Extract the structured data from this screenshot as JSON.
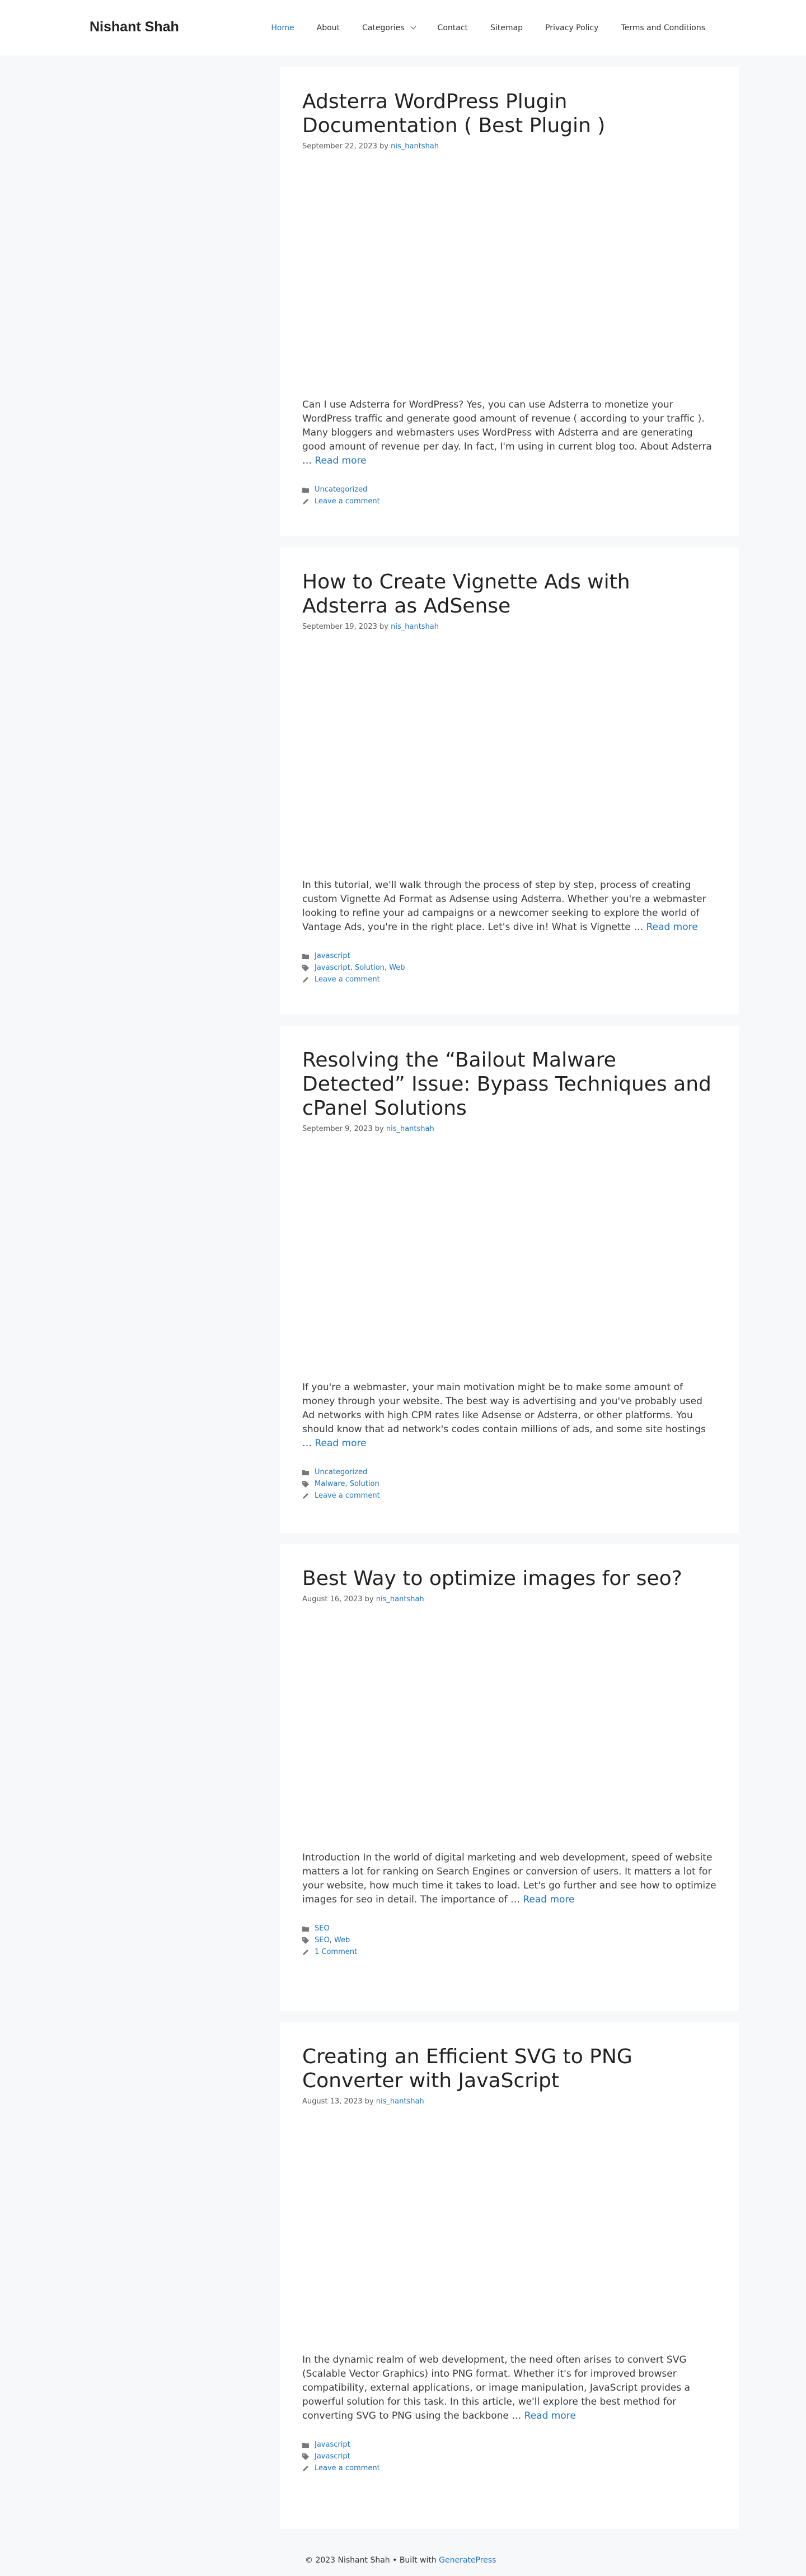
{
  "site": {
    "title": "Nishant Shah"
  },
  "nav": [
    {
      "label": "Home",
      "active": true
    },
    {
      "label": "About"
    },
    {
      "label": "Categories",
      "dropdown": true
    },
    {
      "label": "Contact"
    },
    {
      "label": "Sitemap"
    },
    {
      "label": "Privacy Policy"
    },
    {
      "label": "Terms and Conditions"
    }
  ],
  "read_more": "Read more",
  "posts": [
    {
      "title": "Adsterra WordPress Plugin Documentation ( Best Plugin )",
      "date": "September 22, 2023",
      "by": "by",
      "author": "nis_hantshah",
      "excerpt": "Can I use Adsterra for WordPress? Yes, you can use Adsterra to monetize your WordPress traffic and generate good amount of revenue ( according to your traffic ). Many bloggers and webmasters uses WordPress with Adsterra and are generating good amount of revenue per day. In fact, I'm using in current blog too. About Adsterra …",
      "categories": [
        "Uncategorized"
      ],
      "tags": [],
      "comments": "Leave a comment"
    },
    {
      "title": "How to Create Vignette Ads with Adsterra as AdSense",
      "date": "September 19, 2023",
      "by": "by",
      "author": "nis_hantshah",
      "excerpt": "In this tutorial, we'll walk through the process of step by step, process of creating custom Vignette Ad Format as Adsense using Adsterra. Whether you're a webmaster looking to refine your ad campaigns or a newcomer seeking to explore the world of Vantage Ads, you're in the right place. Let's dive in! What is Vignette …",
      "categories": [
        "Javascript"
      ],
      "tags": [
        "Javascript",
        "Solution",
        "Web"
      ],
      "comments": "Leave a comment"
    },
    {
      "title": "Resolving the “Bailout Malware Detected” Issue: Bypass Techniques and cPanel Solutions",
      "date": "September 9, 2023",
      "by": "by",
      "author": "nis_hantshah",
      "excerpt": "If you're a webmaster, your main motivation might be to make some amount of money through your website. The best way is advertising and you've probably used Ad networks with high CPM rates like Adsense or Adsterra, or other platforms. You should know that ad network's codes contain millions of ads, and some site hostings …",
      "categories": [
        "Uncategorized"
      ],
      "tags": [
        "Malware",
        "Solution"
      ],
      "comments": "Leave a comment"
    },
    {
      "title": "Best Way to optimize images for seo?",
      "date": "August 16, 2023",
      "by": "by",
      "author": "nis_hantshah",
      "excerpt": "Introduction In the world of digital marketing and web development, speed of website matters a lot for ranking on Search Engines or conversion of users. It matters a lot for your website, how much time it takes to load. Let's go further and see how to optimize images for seo in detail. The importance of …",
      "categories": [
        "SEO"
      ],
      "tags": [
        "SEO",
        "Web"
      ],
      "comments": "1 Comment"
    },
    {
      "title": "Creating an Efficient SVG to PNG Converter with JavaScript",
      "date": "August 13, 2023",
      "by": "by",
      "author": "nis_hantshah",
      "excerpt": "In the dynamic realm of web development, the need often arises to convert SVG (Scalable Vector Graphics) into PNG format. Whether it's for improved browser compatibility, external applications, or image manipulation, JavaScript provides a powerful solution for this task. In this article, we'll explore the best method for converting SVG to PNG using the backbone …",
      "categories": [
        "Javascript"
      ],
      "tags": [
        "Javascript"
      ],
      "comments": "Leave a comment"
    }
  ],
  "footer": {
    "copyright": "© 2023 Nishant Shah • Built with",
    "link": "GeneratePress"
  },
  "icons": {
    "categories": "folder-icon",
    "tags": "tag-icon",
    "comments": "comment-icon"
  },
  "colors": {
    "link": "#1e73be",
    "background": "#f7f8f9",
    "card": "#ffffff",
    "text": "#3a3a3a"
  }
}
